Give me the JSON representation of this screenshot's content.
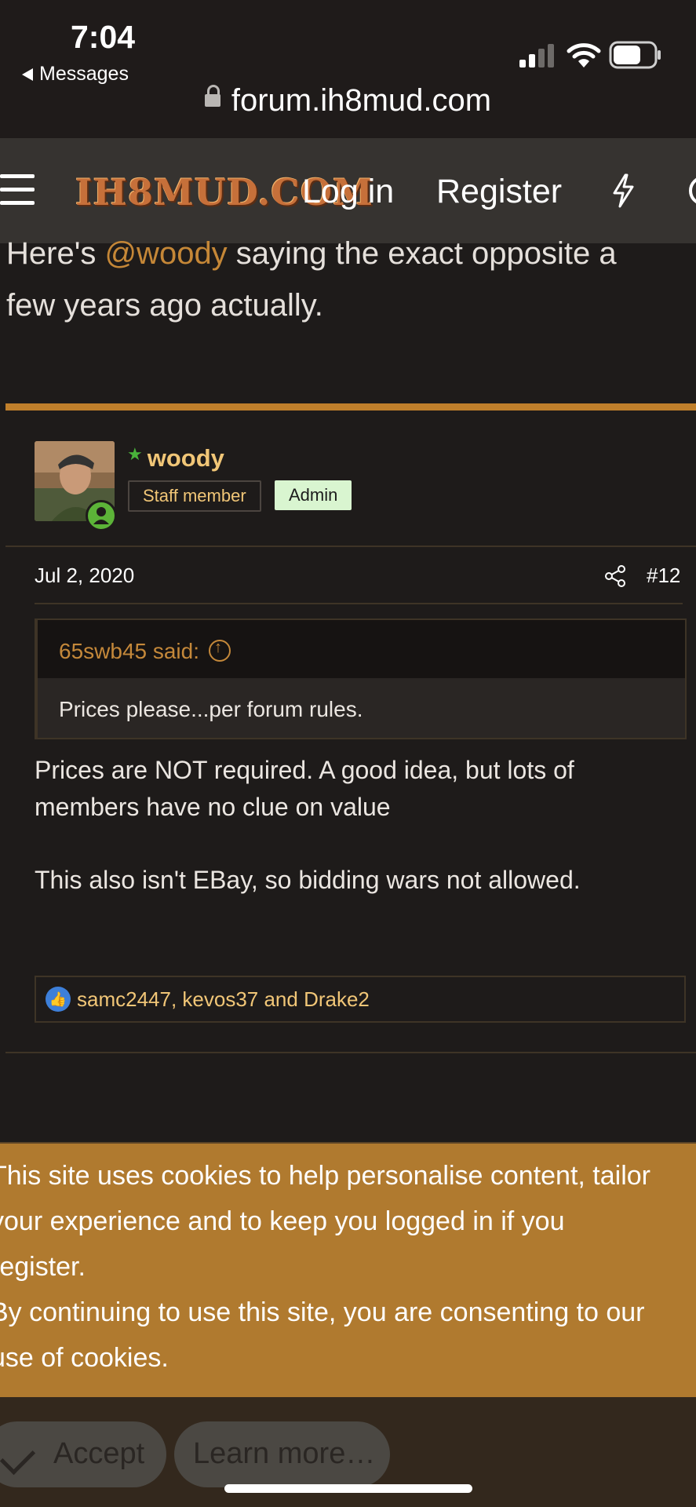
{
  "status_bar": {
    "time": "7:04",
    "back_label": "Messages"
  },
  "browser": {
    "url": "forum.ih8mud.com"
  },
  "header": {
    "logo_text": "IH8MUD.COM",
    "login": "Log in",
    "register": "Register"
  },
  "previous_post": {
    "line1_prefix": "Here's ",
    "mention": "@woody",
    "line1_suffix": " saying the exact opposite a",
    "line2": "few years ago actually."
  },
  "post": {
    "username": "woody",
    "badge_staff": "Staff member",
    "badge_admin": "Admin",
    "date": "Jul 2, 2020",
    "number": "#12",
    "quote": {
      "author": "65swb45 said:",
      "text": "Prices please...per forum rules."
    },
    "body": {
      "p1_line1": "Prices are NOT required. A good idea, but lots of",
      "p1_line2": "members have no clue on value",
      "p2": "This also isn't EBay, so bidding wars not allowed."
    },
    "reactions": "samc2447, kevos37 and Drake2"
  },
  "cookie_notice": {
    "line1": "This site uses cookies to help personalise content, tailor",
    "line2": "your experience and to keep you logged in if you",
    "line3": "register.",
    "line4": "By continuing to use this site, you are consenting to our",
    "line5": "use of cookies.",
    "accept_label": "Accept",
    "learn_more_label": "Learn more…"
  },
  "colors": {
    "accent": "#c07f2b",
    "username": "#f1c677",
    "cookie_bg": "#b07a2f",
    "admin_badge": "#d9f5d0"
  }
}
